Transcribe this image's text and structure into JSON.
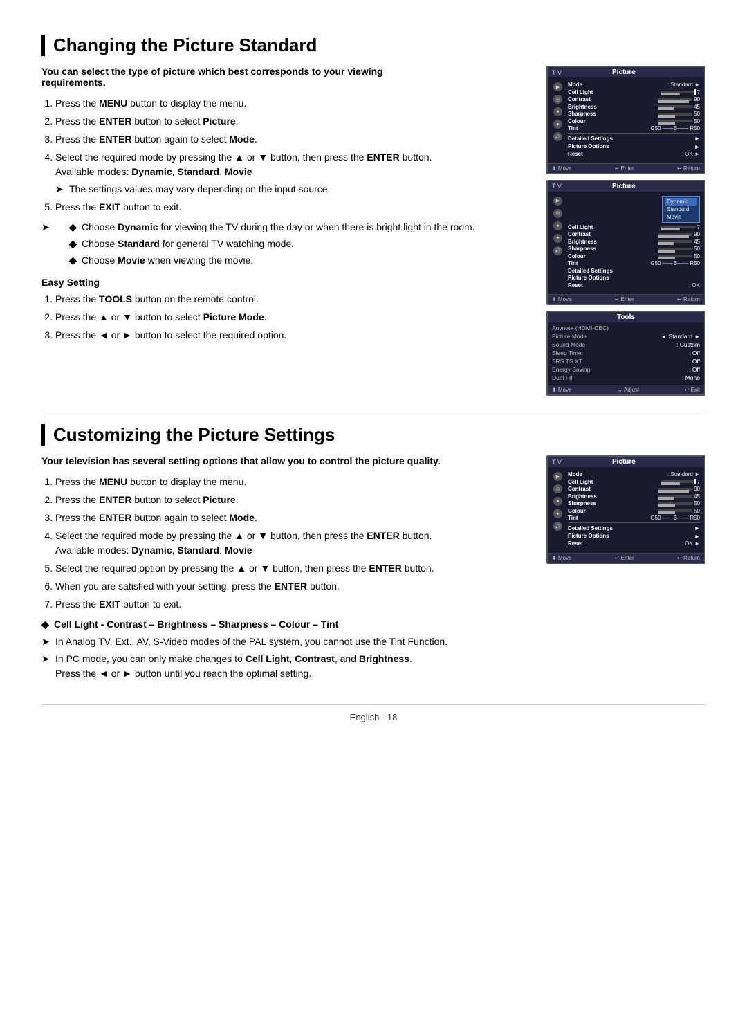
{
  "section1": {
    "title": "Changing the Picture Standard",
    "intro": "You can select the type of picture which best corresponds to your viewing requirements.",
    "steps": [
      {
        "num": 1,
        "text": "Press the ",
        "bold": "MENU",
        "rest": " button to display the menu."
      },
      {
        "num": 2,
        "text": "Press the ",
        "bold": "ENTER",
        "rest": " button to select ",
        "bold2": "Picture",
        "rest2": "."
      },
      {
        "num": 3,
        "text": "Press the ",
        "bold": "ENTER",
        "rest": " button again to select ",
        "bold2": "Mode",
        "rest2": "."
      },
      {
        "num": 4,
        "text_before": "Select the required mode by pressing the ▲ or ▼ button, then press the ",
        "bold": "ENTER",
        "rest": " button."
      },
      {
        "num": 5,
        "text": "Press the ",
        "bold": "EXIT",
        "rest": " button to exit."
      }
    ],
    "available_modes_label": "Available modes: ",
    "available_modes": "Dynamic, Standard, Movie",
    "arrow_note": "The settings values may vary depending on the input source.",
    "diamond_notes": [
      "Choose Dynamic for viewing the TV during the day or when there is bright light in the room.",
      "Choose Standard for general TV watching mode.",
      "Choose Movie when viewing the movie."
    ],
    "easy_setting": {
      "header": "Easy Setting",
      "steps": [
        {
          "num": 1,
          "text": "Press the ",
          "bold": "TOOLS",
          "rest": " button on the remote control."
        },
        {
          "num": 2,
          "text": "Press the ▲ or ▼ button to select ",
          "bold": "Picture Mode",
          "rest": "."
        },
        {
          "num": 3,
          "text": "Press the ◄ or ► button to select the required option."
        }
      ]
    }
  },
  "section2": {
    "title": "Customizing the Picture Settings",
    "intro": "Your television has several setting options that allow you to control the picture quality.",
    "steps": [
      {
        "num": 1,
        "text": "Press the ",
        "bold": "MENU",
        "rest": " button to display the menu."
      },
      {
        "num": 2,
        "text": "Press the ",
        "bold": "ENTER",
        "rest": " button to select ",
        "bold2": "Picture",
        "rest2": "."
      },
      {
        "num": 3,
        "text": "Press the ",
        "bold": "ENTER",
        "rest": " button again to select ",
        "bold2": "Mode",
        "rest2": "."
      },
      {
        "num": 4,
        "text_before": "Select the required mode by pressing the ▲ or ▼ button, then press the ",
        "bold": "ENTER",
        "rest": " button."
      },
      {
        "num": 5,
        "text_before": "Select the required option by pressing the ▲ or ▼ button, then press the ",
        "bold": "ENTER",
        "rest": " button."
      },
      {
        "num": 6,
        "text": "When you are satisfied with your setting, press the ",
        "bold": "ENTER",
        "rest": " button."
      },
      {
        "num": 7,
        "text": "Press the ",
        "bold": "EXIT",
        "rest": " button to exit."
      }
    ],
    "available_modes_label": "Available modes: ",
    "available_modes": "Dynamic, Standard, Movie",
    "diamond_main": "Cell Light - Contrast – Brightness – Sharpness – Colour – Tint",
    "arrow_notes": [
      "In Analog TV, Ext., AV, S-Video modes of the PAL system, you cannot use the Tint Function.",
      "In PC mode, you can only make changes to Cell Light, Contrast, and Brightness.",
      "Press the ◄ or ► button until you reach the optimal setting."
    ]
  },
  "footer": {
    "text": "English - 18"
  },
  "tv_screens": {
    "screen1": {
      "label": "T V",
      "title": "Picture",
      "mode": "Standard",
      "rows": [
        {
          "label": "Mode",
          "value": ": Standard",
          "arrow": true
        },
        {
          "label": "Cell Light",
          "bar": 55,
          "value": "7"
        },
        {
          "label": "Contrast",
          "bar": 90,
          "value": "90"
        },
        {
          "label": "Brightness",
          "bar": 45,
          "value": "45"
        },
        {
          "label": "Sharpness",
          "bar": 50,
          "value": "50"
        },
        {
          "label": "Colour",
          "bar": 50,
          "value": "50"
        },
        {
          "label": "Tint",
          "value": "G50  B  R50"
        },
        {
          "label": "Detailed Settings",
          "arrow": true
        },
        {
          "label": "Picture Options",
          "arrow": true
        },
        {
          "label": "Reset",
          "value": ": OK",
          "arrow": true
        }
      ],
      "footer": [
        "⬍ Move",
        "↵ Enter",
        "↩ Return"
      ]
    },
    "screen2": {
      "label": "T V",
      "title": "Picture",
      "mode_popup": [
        "Dynamic",
        "Standard",
        "Movie"
      ],
      "rows": [
        {
          "label": "Cell Light",
          "bar": 55,
          "value": "7"
        },
        {
          "label": "Contrast",
          "bar": 90,
          "value": "90"
        },
        {
          "label": "Brightness",
          "bar": 45,
          "value": "45"
        },
        {
          "label": "Sharpness",
          "bar": 50,
          "value": "50"
        },
        {
          "label": "Colour",
          "bar": 50,
          "value": "50"
        },
        {
          "label": "Tint",
          "value": "G50  B  R50"
        },
        {
          "label": "Detailed Settings"
        },
        {
          "label": "Picture Options"
        },
        {
          "label": "Reset",
          "value": ": OK"
        }
      ],
      "footer": [
        "⬍ Move",
        "↵ Enter",
        "↩ Return"
      ]
    },
    "screen3": {
      "title": "Tools",
      "rows": [
        {
          "label": "Anynet+ (HDMI-CEC)"
        },
        {
          "label": "Picture Mode",
          "value": "Standard",
          "nav": true
        },
        {
          "label": "Sound Mode",
          "value": ": Custom"
        },
        {
          "label": "Sleep Timer",
          "value": ": Off"
        },
        {
          "label": "SRS TS XT",
          "value": ": Off"
        },
        {
          "label": "Energy Saving",
          "value": ": Off"
        },
        {
          "label": "Dual I-II",
          "value": ": Mono"
        }
      ],
      "footer": [
        "⬍ Move",
        "↔ Adjust",
        "↩ Exit"
      ]
    },
    "screen4": {
      "label": "T V",
      "title": "Picture",
      "rows": [
        {
          "label": "Mode",
          "value": ": Standard",
          "arrow": true
        },
        {
          "label": "Cell Light",
          "bar": 55,
          "value": "7"
        },
        {
          "label": "Contrast",
          "bar": 90,
          "value": "90"
        },
        {
          "label": "Brightness",
          "bar": 45,
          "value": "45"
        },
        {
          "label": "Sharpness",
          "bar": 50,
          "value": "50"
        },
        {
          "label": "Colour",
          "bar": 50,
          "value": "50"
        },
        {
          "label": "Tint",
          "value": "G50  B  R50"
        },
        {
          "label": "Detailed Settings",
          "arrow": true
        },
        {
          "label": "Picture Options",
          "arrow": true
        },
        {
          "label": "Reset",
          "value": ": OK",
          "arrow": true
        }
      ],
      "footer": [
        "⬍ Move",
        "↵ Enter",
        "↩ Return"
      ]
    }
  }
}
